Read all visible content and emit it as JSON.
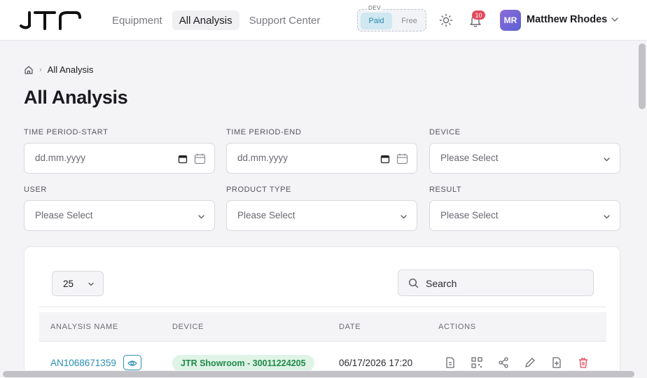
{
  "header": {
    "logo_text": "JTR",
    "nav": [
      {
        "label": "Equipment",
        "active": false
      },
      {
        "label": "All Analysis",
        "active": true
      },
      {
        "label": "Support Center",
        "active": false
      }
    ],
    "env": {
      "label": "DEV",
      "paid": "Paid",
      "free": "Free"
    },
    "notifications_count": "10",
    "user": {
      "initials": "MR",
      "name": "Matthew Rhodes"
    }
  },
  "breadcrumb": {
    "current": "All Analysis"
  },
  "page_title": "All Analysis",
  "filters": {
    "time_start": {
      "label": "TIME PERIOD-START",
      "placeholder": "dd.mm.yyyy"
    },
    "time_end": {
      "label": "TIME PERIOD-END",
      "placeholder": "dd.mm.yyyy"
    },
    "device": {
      "label": "DEVICE",
      "value": "Please Select"
    },
    "user": {
      "label": "USER",
      "value": "Please Select"
    },
    "product_type": {
      "label": "PRODUCT TYPE",
      "value": "Please Select"
    },
    "result": {
      "label": "RESULT",
      "value": "Please Select"
    }
  },
  "table": {
    "page_size": "25",
    "search_placeholder": "Search",
    "columns": [
      "ANALYSIS NAME",
      "DEVICE",
      "DATE",
      "ACTIONS"
    ],
    "rows": [
      {
        "name": "AN1068671359",
        "device": "JTR Showroom - 30011224205",
        "date": "06/17/2026 17:20"
      }
    ]
  },
  "colors": {
    "accent": "#2a8fb5",
    "danger": "#e5495c",
    "success_bg": "#dff3e6",
    "success_text": "#1f8a4c"
  }
}
